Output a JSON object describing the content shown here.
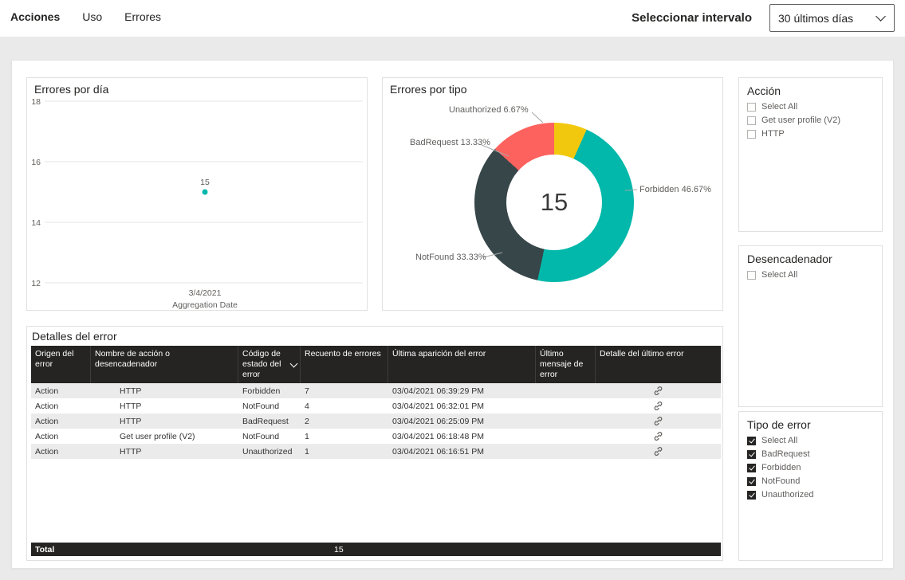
{
  "topbar": {
    "tabs": [
      "Acciones",
      "Uso",
      "Errores"
    ],
    "interval_label": "Seleccionar intervalo",
    "interval_value": "30 últimos días"
  },
  "colors": {
    "accent_teal": "#01b8aa",
    "dark_slate": "#374649",
    "red": "#fd625e",
    "yellow": "#f2c80f",
    "table_header_bg": "#252423",
    "content_bg": "#eaeaea"
  },
  "errors_by_day": {
    "title": "Errores por día",
    "chart_data": {
      "type": "scatter",
      "x": [
        "3/4/2021"
      ],
      "values": [
        15
      ],
      "point_label": "15",
      "point_color": "#01b8aa",
      "xlabel": "Aggregation Date",
      "ylabel": "",
      "ylim": [
        12,
        18
      ],
      "y_ticks": [
        18,
        16,
        14,
        12
      ],
      "grid": "horizontal"
    }
  },
  "errors_by_type": {
    "title": "Errores por tipo",
    "center_value": "15",
    "chart_data": {
      "type": "pie",
      "donut": true,
      "labels": [
        "Unauthorized",
        "Forbidden",
        "NotFound",
        "BadRequest"
      ],
      "values": [
        6.67,
        46.67,
        33.33,
        13.33
      ],
      "colors": [
        "#f2c80f",
        "#01b8aa",
        "#374649",
        "#fd625e"
      ],
      "center_total": 15
    },
    "callouts": {
      "unauthorized": "Unauthorized 6.67%",
      "badrequest": "BadRequest 13.33%",
      "notfound": "NotFound 33.33%",
      "forbidden": "Forbidden 46.67%"
    }
  },
  "slicers": {
    "action": {
      "title": "Acción",
      "items": [
        {
          "label": "Select All",
          "checked": false
        },
        {
          "label": "Get user profile (V2)",
          "checked": false
        },
        {
          "label": "HTTP",
          "checked": false
        }
      ]
    },
    "trigger": {
      "title": "Desencadenador",
      "items": [
        {
          "label": "Select All",
          "checked": false
        }
      ]
    },
    "error_type": {
      "title": "Tipo de error",
      "items": [
        {
          "label": "Select All",
          "checked": true
        },
        {
          "label": "BadRequest",
          "checked": true
        },
        {
          "label": "Forbidden",
          "checked": true
        },
        {
          "label": "NotFound",
          "checked": true
        },
        {
          "label": "Unauthorized",
          "checked": true
        }
      ]
    }
  },
  "details": {
    "title": "Detalles del error",
    "columns": [
      "Origen del error",
      "Nombre de acción o desencadenador",
      "Código de estado del error",
      "Recuento de errores",
      "Última aparición del error",
      "Último mensaje de error",
      "Detalle del último error"
    ],
    "rows": [
      {
        "origin": "Action",
        "name": "HTTP",
        "code": "Forbidden",
        "count": "7",
        "last_seen": "03/04/2021 06:39:29 PM",
        "message": ""
      },
      {
        "origin": "Action",
        "name": "HTTP",
        "code": "NotFound",
        "count": "4",
        "last_seen": "03/04/2021 06:32:01 PM",
        "message": ""
      },
      {
        "origin": "Action",
        "name": "HTTP",
        "code": "BadRequest",
        "count": "2",
        "last_seen": "03/04/2021 06:25:09 PM",
        "message": ""
      },
      {
        "origin": "Action",
        "name": "Get user profile (V2)",
        "code": "NotFound",
        "count": "1",
        "last_seen": "03/04/2021 06:18:48 PM",
        "message": ""
      },
      {
        "origin": "Action",
        "name": "HTTP",
        "code": "Unauthorized",
        "count": "1",
        "last_seen": "03/04/2021 06:16:51 PM",
        "message": ""
      }
    ],
    "total_label": "Total",
    "total_value": "15"
  }
}
